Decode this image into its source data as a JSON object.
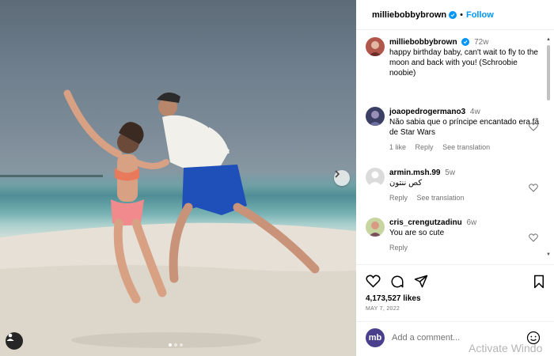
{
  "post": {
    "author": "milliebobbybrown",
    "follow_label": "Follow",
    "caption": {
      "user": "milliebobbybrown",
      "time": "72w",
      "text": "happy birthday baby, can't wait to fly to the moon and back with you! (Schroobie noobie)"
    },
    "likes": "4,173,527 likes",
    "date": "MAY 7, 2022"
  },
  "comments": [
    {
      "user": "joaopedrogermano3",
      "time": "4w",
      "text": "Não sabia que o príncipe encantado era fã de Star Wars",
      "likes": "1 like",
      "reply": "Reply",
      "translate": "See translation"
    },
    {
      "user": "armin.msh.99",
      "time": "5w",
      "text": "كص ننتون",
      "reply": "Reply",
      "translate": "See translation"
    },
    {
      "user": "cris_crengutzadinu",
      "time": "6w",
      "text": "You are so cute",
      "reply": "Reply"
    }
  ],
  "add_comment": {
    "placeholder": "Add a comment...",
    "avatar_text": "mb"
  },
  "watermark": "Activate Windo",
  "icons": {
    "verified": "verified-badge-icon",
    "like": "heart-icon",
    "comment": "comment-icon",
    "share": "paper-plane-icon",
    "save": "bookmark-icon",
    "emoji": "emoji-icon",
    "next": "chevron-right-icon",
    "tag": "user-tag-icon"
  },
  "colors": {
    "accent": "#0095f6",
    "muted": "#737373"
  },
  "carousel": {
    "slides": 3,
    "active": 1
  }
}
